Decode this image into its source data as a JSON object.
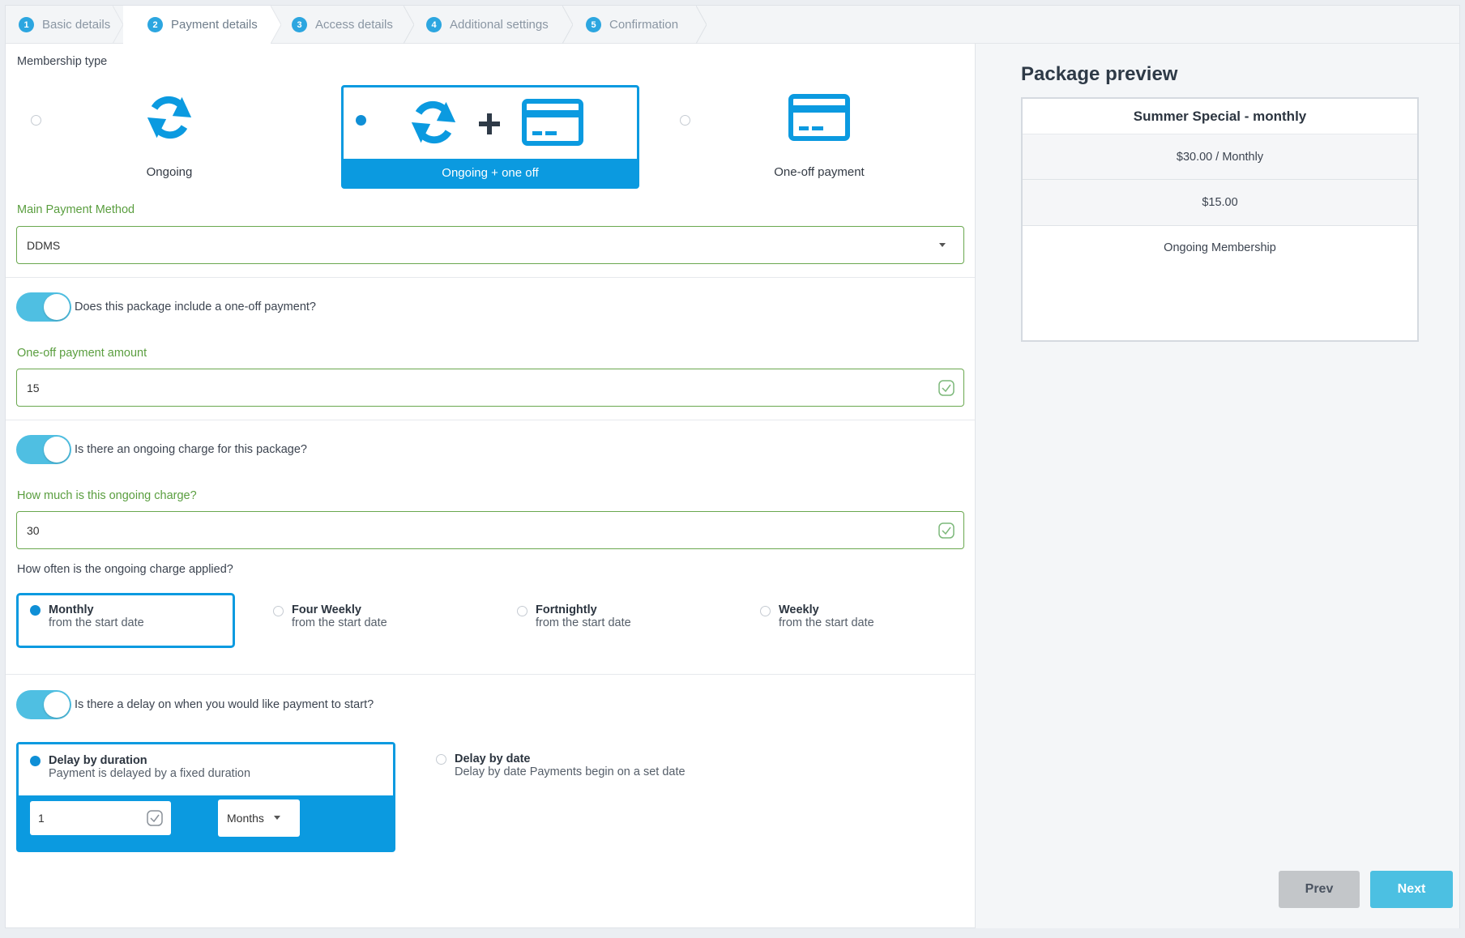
{
  "steps": [
    {
      "num": "1",
      "label": "Basic details"
    },
    {
      "num": "2",
      "label": "Payment details"
    },
    {
      "num": "3",
      "label": "Access details"
    },
    {
      "num": "4",
      "label": "Additional settings"
    },
    {
      "num": "5",
      "label": "Confirmation"
    }
  ],
  "active_step": 2,
  "membership": {
    "label": "Membership type",
    "options": [
      {
        "title": "Ongoing",
        "icon": "sync-icon",
        "selected": false
      },
      {
        "title": "Ongoing + one off",
        "icon": "sync-plus-card-icon",
        "selected": true
      },
      {
        "title": "One-off payment",
        "icon": "credit-card-icon",
        "selected": false
      }
    ]
  },
  "main_payment": {
    "label": "Main Payment Method",
    "value": "DDMS"
  },
  "one_off": {
    "question": "Does this package include a one-off payment?",
    "enabled": true,
    "amount_label": "One-off payment amount",
    "amount_value": "15"
  },
  "ongoing": {
    "question": "Is there an ongoing charge for this package?",
    "enabled": true,
    "amount_label": "How much is this ongoing charge?",
    "amount_value": "30",
    "frequency_label": "How often is the ongoing charge applied?",
    "frequencies": [
      {
        "title": "Monthly",
        "sub": "from the start date",
        "selected": true
      },
      {
        "title": "Four Weekly",
        "sub": "from the start date",
        "selected": false
      },
      {
        "title": "Fortnightly",
        "sub": "from the start date",
        "selected": false
      },
      {
        "title": "Weekly",
        "sub": "from the start date",
        "selected": false
      }
    ]
  },
  "delay": {
    "question": "Is there a delay on when you would like payment to start?",
    "enabled": true,
    "by_duration": {
      "title": "Delay by duration",
      "sub": "Payment is delayed by a fixed duration",
      "selected": true
    },
    "by_date": {
      "title": "Delay by date",
      "sub": "Delay by date Payments begin on a set date",
      "selected": false
    },
    "duration_value": "1",
    "duration_unit": "Months"
  },
  "preview": {
    "title": "Package preview",
    "package_name": "Summer Special - monthly",
    "ongoing_price": "$30.00 / Monthly",
    "one_off_price": "$15.00",
    "membership_type": "Ongoing Membership"
  },
  "buttons": {
    "prev": "Prev",
    "next": "Next"
  },
  "colors": {
    "accent": "#0b9ae0",
    "toggle": "#4fbfe2",
    "valid_green": "#6aa84f",
    "prev_button": "#c3c6c9",
    "next_button": "#4cc0e2"
  }
}
